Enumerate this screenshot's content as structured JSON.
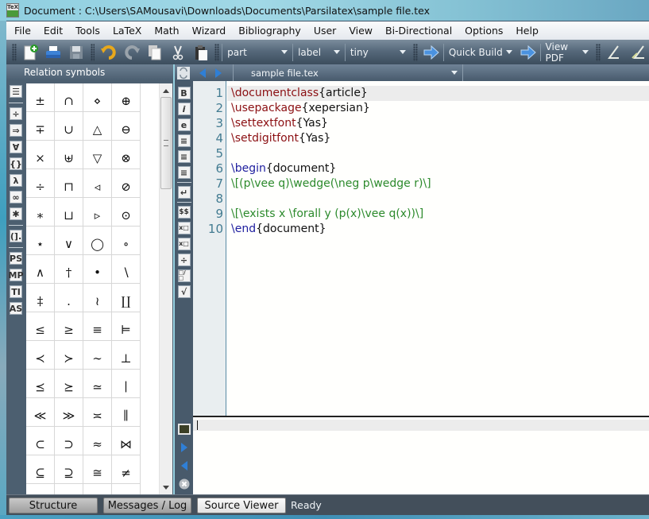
{
  "window": {
    "app_icon": "texmaker-logo",
    "title": "Document : C:\\Users\\SAMousavi\\Downloads\\Documents\\Parsilatex\\sample file.tex"
  },
  "menu": [
    {
      "label": "File"
    },
    {
      "label": "Edit"
    },
    {
      "label": "Tools"
    },
    {
      "label": "LaTeX"
    },
    {
      "label": "Math"
    },
    {
      "label": "Wizard"
    },
    {
      "label": "Bibliography"
    },
    {
      "label": "User"
    },
    {
      "label": "View"
    },
    {
      "label": "Bi-Directional"
    },
    {
      "label": "Options"
    },
    {
      "label": "Help"
    }
  ],
  "toolbar": {
    "buttons": [
      "new-file",
      "print",
      "save",
      "undo",
      "redo",
      "copy",
      "cut",
      "paste"
    ],
    "sectioning_combo": "part",
    "label_combo": "label",
    "size_combo": "tiny",
    "build_combo": "Quick Build",
    "view_combo": "View PDF"
  },
  "structure_panel": {
    "title": "Relation symbols",
    "categories": [
      {
        "icon": "structure-icon",
        "glyph": "☰"
      },
      {
        "icon": "relation-symbols-icon",
        "glyph": "÷"
      },
      {
        "icon": "arrows-icon",
        "glyph": "⇒"
      },
      {
        "icon": "misc-symbols-icon",
        "glyph": "∀"
      },
      {
        "icon": "delimiters-icon",
        "glyph": "{}"
      },
      {
        "icon": "greek-icon",
        "glyph": "λ"
      },
      {
        "icon": "infinity-icon",
        "glyph": "∞"
      },
      {
        "icon": "operators-icon",
        "glyph": "✱"
      },
      {
        "icon": "left-right-icon",
        "glyph": "(]."
      },
      {
        "icon": "pstricks-icon",
        "glyph": "PS"
      },
      {
        "icon": "metapost-icon",
        "glyph": "MP"
      },
      {
        "icon": "tikz-icon",
        "glyph": "TI"
      },
      {
        "icon": "asymptote-icon",
        "glyph": "AS"
      }
    ],
    "symbols": [
      "±",
      "∩",
      "⋄",
      "⊕",
      "∓",
      "∪",
      "△",
      "⊖",
      "×",
      "⊎",
      "▽",
      "⊗",
      "÷",
      "⊓",
      "◃",
      "⊘",
      "∗",
      "⊔",
      "▹",
      "⊙",
      "⋆",
      "∨",
      "◯",
      "∘",
      "∧",
      "†",
      "•",
      "∖",
      "‡",
      ".",
      "≀",
      "∐",
      "≤",
      "≥",
      "≡",
      "⊨",
      "≺",
      "≻",
      "∼",
      "⊥",
      "⪯",
      "⪰",
      "≃",
      "∣",
      "≪",
      "≫",
      "≍",
      "∥",
      "⊂",
      "⊃",
      "≈",
      "⋈",
      "⊆",
      "⊇",
      "≅",
      "≠",
      "",
      "",
      "",
      ""
    ]
  },
  "editor": {
    "file_tab": "sample file.tex",
    "format_buttons": [
      "B",
      "i",
      "e",
      "≡",
      "≡",
      "↵",
      "$$",
      "x□",
      "x□",
      "÷",
      "□/□",
      "√"
    ],
    "lines": [
      {
        "n": "1",
        "tokens": [
          {
            "t": "\\documentclass",
            "k": "cmd"
          },
          {
            "t": "{article}",
            "k": "txt"
          }
        ]
      },
      {
        "n": "2",
        "tokens": [
          {
            "t": "\\usepackage",
            "k": "cmd"
          },
          {
            "t": "{xepersian}",
            "k": "txt"
          }
        ]
      },
      {
        "n": "3",
        "tokens": [
          {
            "t": "\\settextfont",
            "k": "cmd"
          },
          {
            "t": "{Yas}",
            "k": "txt"
          }
        ]
      },
      {
        "n": "4",
        "tokens": [
          {
            "t": "\\setdigitfont",
            "k": "cmd"
          },
          {
            "t": "{Yas}",
            "k": "txt"
          }
        ]
      },
      {
        "n": "5",
        "tokens": []
      },
      {
        "n": "6",
        "tokens": [
          {
            "t": "\\begin",
            "k": "env"
          },
          {
            "t": "{document}",
            "k": "txt"
          }
        ]
      },
      {
        "n": "7",
        "tokens": [
          {
            "t": "\\[(p\\vee q)\\wedge(\\neg p\\wedge r)\\]",
            "k": "math"
          }
        ]
      },
      {
        "n": "8",
        "tokens": []
      },
      {
        "n": "9",
        "tokens": [
          {
            "t": "\\[\\exists x \\forall y (p(x)\\vee q(x))\\]",
            "k": "math"
          }
        ]
      },
      {
        "n": "10",
        "tokens": [
          {
            "t": "\\end",
            "k": "env"
          },
          {
            "t": "{document}",
            "k": "txt"
          }
        ]
      }
    ]
  },
  "log": {
    "content": ""
  },
  "statusbar": {
    "tabs": [
      {
        "label": "Structure",
        "active": false
      },
      {
        "label": "Messages / Log",
        "active": false
      },
      {
        "label": "Source Viewer",
        "active": true
      }
    ],
    "status": "Ready"
  }
}
